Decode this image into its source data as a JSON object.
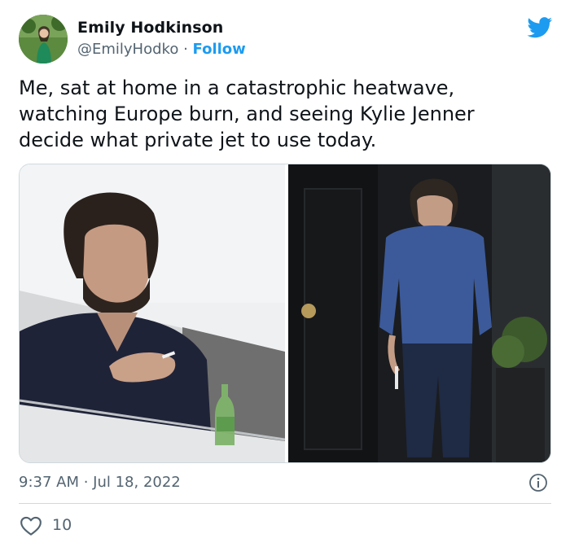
{
  "author": {
    "display_name": "Emily Hodkinson",
    "handle": "@EmilyHodko",
    "separator": " · ",
    "follow_label": "Follow",
    "avatar_icon": "avatar"
  },
  "brand": {
    "icon": "twitter-bird-icon",
    "color": "#1d9bf0"
  },
  "tweet": {
    "text": "Me, sat at home in a catastrophic heatwave,\nwatching Europe burn, and seeing Kylie Jenner\ndecide what private jet to use today."
  },
  "media": {
    "count": 2
  },
  "meta": {
    "timestamp": "9:37 AM · Jul 18, 2022",
    "info_icon": "info-icon"
  },
  "actions": {
    "like_icon": "heart-icon",
    "like_count": "10"
  }
}
